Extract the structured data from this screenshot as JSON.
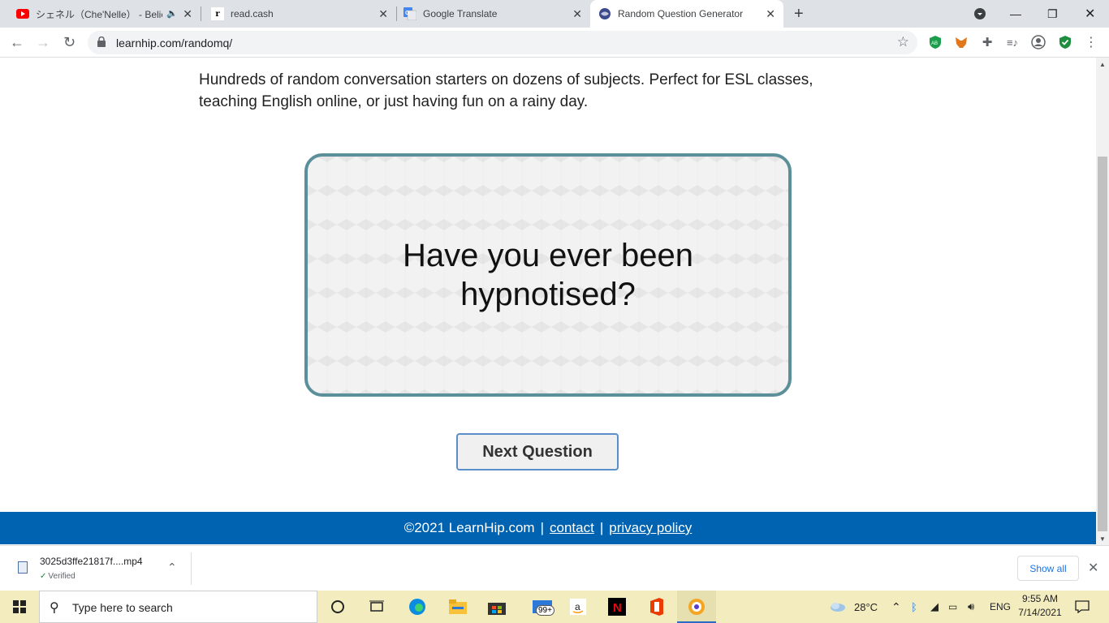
{
  "browser": {
    "tabs": [
      {
        "title": "シェネル（Che'Nelle） - Believ",
        "favicon": "youtube-icon"
      },
      {
        "title": "read.cash",
        "favicon": "readcash-icon"
      },
      {
        "title": "Google Translate",
        "favicon": "google-translate-icon"
      },
      {
        "title": "Random Question Generator",
        "favicon": "globe-icon",
        "active": true
      }
    ],
    "url": "learnhip.com/randomq/"
  },
  "page": {
    "intro": "Hundreds of random conversation starters on dozens of subjects. Perfect for ESL classes, teaching English online, or just having fun on a rainy day.",
    "question": "Have you ever been hypnotised?",
    "next_button": "Next Question",
    "footer": {
      "copyright": "©2021 LearnHip.com",
      "separator": "|",
      "contact": "contact",
      "privacy": "privacy policy"
    }
  },
  "downloads": {
    "file_name": "3025d3ffe21817f....mp4",
    "status": "Verified",
    "show_all": "Show all"
  },
  "taskbar": {
    "search_placeholder": "Type here to search",
    "mail_badge": "99+",
    "weather": "28°C",
    "language": "ENG",
    "time": "9:55 AM",
    "date": "7/14/2021"
  },
  "colors": {
    "footer": "#0063b1",
    "card_border": "#5b8f99",
    "taskbar": "#f3ecbf"
  }
}
